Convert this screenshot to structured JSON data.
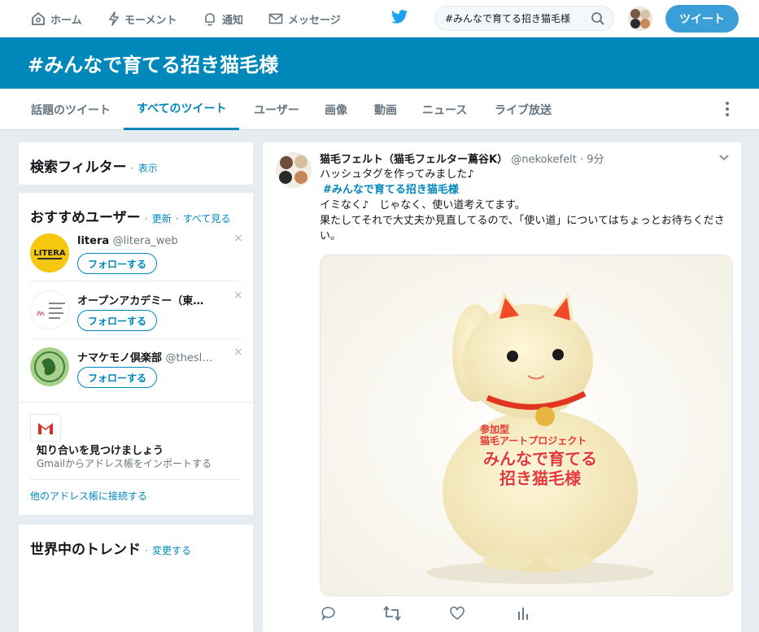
{
  "nav": {
    "home": "ホーム",
    "moments": "モーメント",
    "notifications": "通知",
    "messages": "メッセージ",
    "search_value": "#みんなで育てる招き猫毛様",
    "tweet_button": "ツイート"
  },
  "header": {
    "title": "#みんなで育てる招き猫毛様"
  },
  "tabs": [
    "話題のツイート",
    "すべてのツイート",
    "ユーザー",
    "画像",
    "動画",
    "ニュース",
    "ライブ放送"
  ],
  "sidebar": {
    "filter": {
      "title": "検索フィルター",
      "show": "表示"
    },
    "who_to_follow": {
      "title": "おすすめユーザー",
      "refresh": "更新",
      "view_all": "すべて見る",
      "users": [
        {
          "name": "litera",
          "handle": "@litera_web",
          "follow": "フォローする",
          "close": "×"
        },
        {
          "name": "オープンアカデミー（東…",
          "handle": "",
          "follow": "フォローする",
          "close": "×"
        },
        {
          "name": "ナマケモノ倶楽部",
          "handle": "@thesl…",
          "follow": "フォローする",
          "close": "×"
        }
      ],
      "find_friends_title": "知り合いを見つけましょう",
      "find_friends_sub": "Gmailからアドレス帳をインポートする",
      "connect_other": "他のアドレス帳に接続する"
    },
    "trends": {
      "title": "世界中のトレンド",
      "change": "変更する"
    }
  },
  "tweet": {
    "author": "猫毛フェルト（猫毛フェルター蔦谷K）",
    "handle": "@nekokefelt",
    "time": "9分",
    "lines": {
      "l1": "ハッシュタグを作ってみました♪",
      "tag": "#みんなで育てる招き猫毛様",
      "l3": "イミなく♪　じゃなく、使い道考えてます。",
      "l4": "果たしてそれで大丈夫か見直してるので、「使い道」についてはちょっとお待ちください。"
    },
    "image_text": {
      "small1": "参加型",
      "small2": "猫毛アートプロジェクト",
      "big1": "みんなで育てる",
      "big2": "招き猫毛様"
    }
  },
  "colors": {
    "brand": "#0088bb",
    "tweet_button": "#3a9fd6",
    "accent_red": "#e53935"
  }
}
